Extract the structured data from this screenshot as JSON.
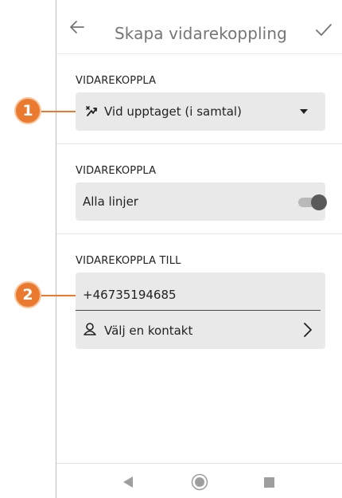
{
  "appbar": {
    "title": "Skapa vidarekoppling"
  },
  "section1": {
    "label": "VIDAREKOPPLA",
    "selected_option": "Vid upptaget (i samtal)"
  },
  "section2": {
    "label": "VIDAREKOPPLA",
    "line_text": "Alla linjer",
    "toggle_on": true
  },
  "section3": {
    "label": "VIDAREKOPPLA TILL",
    "phone_number": "+46735194685",
    "contact_label": "Välj en kontakt"
  },
  "callouts": [
    "1",
    "2"
  ],
  "colors": {
    "callout": "#ea7a2f",
    "field_bg": "#e9e9e9",
    "toggle_thumb": "#5a5a5a"
  },
  "icons": {
    "back": "arrow-left-icon",
    "confirm": "check-icon",
    "busy": "call-busy-icon",
    "dropdown": "dropdown-arrow-icon",
    "contact": "person-icon",
    "chevron": "chevron-right-icon"
  }
}
